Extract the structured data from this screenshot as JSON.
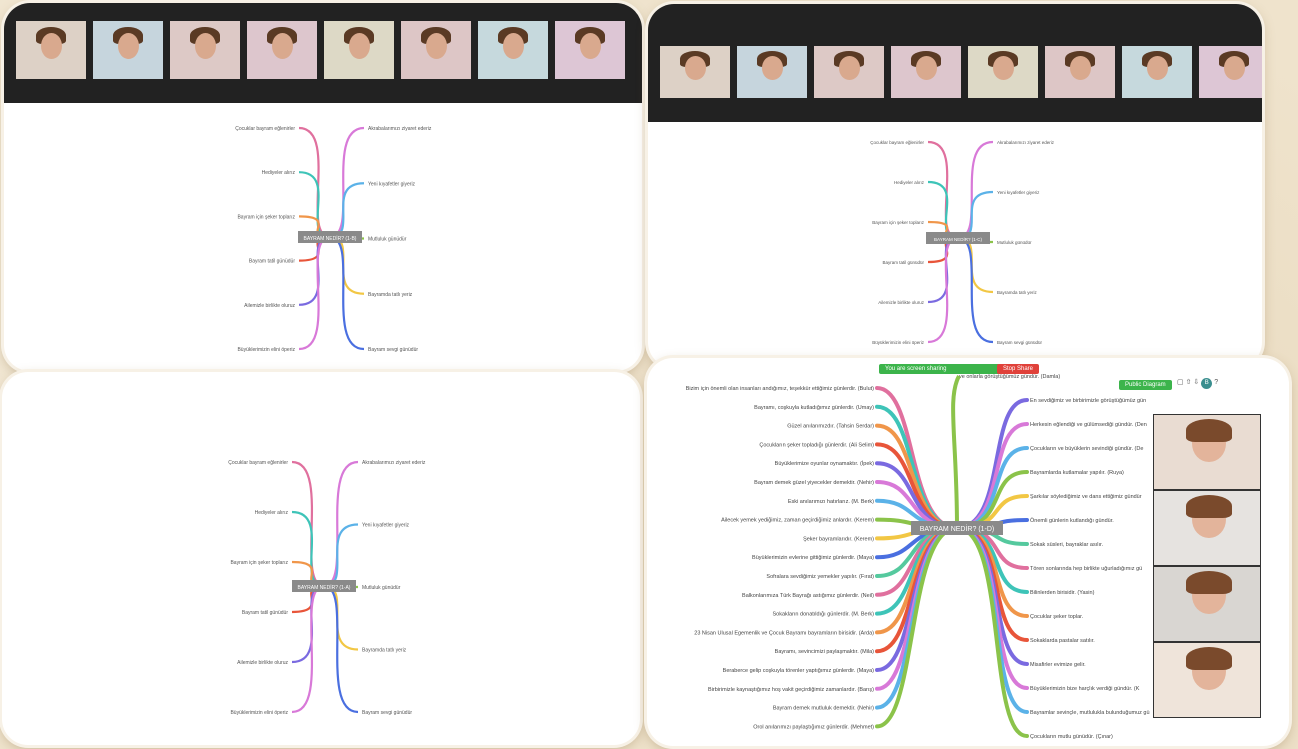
{
  "screen1": {
    "participants": [
      "",
      "",
      "",
      "",
      "",
      "",
      "",
      ""
    ],
    "center": "BAYRAM NEDİR? (1-B)",
    "branches": [
      "Çocuklar bayram eğlenirler",
      "Hediyeler alırız",
      "Bayram için şeker toplarız",
      "Bayram tatil günüdür",
      "Ailemizle birlikte oluruz",
      "Büyüklerimizin elini öperiz",
      "Akrabalarımızı ziyaret ederiz",
      "Yeni kıyafetler giyeriz",
      "Mutluluk günüdür",
      "Bayramda tatlı yeriz",
      "Bayram sevgi günüdür"
    ]
  },
  "screen2": {
    "participants": [
      "",
      "",
      "",
      "",
      "",
      "",
      "",
      ""
    ],
    "center": "BAYRAM NEDİR? (1-C)",
    "branches": [
      "Çocuklar bayram eğlenirler",
      "Hediyeler alırız",
      "Bayram için şeker toplarız",
      "Bayram tatil günüdür",
      "Ailemizle birlikte oluruz",
      "Büyüklerimizin elini öperiz",
      "Akrabalarımızı ziyaret ederiz",
      "Yeni kıyafetler giyeriz",
      "Mutluluk günüdür",
      "Bayramda tatlı yeriz",
      "Bayram sevgi günüdür"
    ]
  },
  "screen3": {
    "center": "BAYRAM NEDİR? (1-A)",
    "branches": [
      "Çocuklar bayram eğlenirler",
      "Hediyeler alırız",
      "Bayram için şeker toplarız",
      "Bayram tatil günüdür",
      "Ailemizle birlikte oluruz",
      "Büyüklerimizin elini öperiz",
      "Akrabalarımızı ziyaret ederiz",
      "Yeni kıyafetler giyeriz",
      "Mutluluk günüdür",
      "Bayramda tatlı yeriz",
      "Bayram sevgi günüdür"
    ]
  },
  "screen4": {
    "center": "BAYRAM NEDİR? (1-D)",
    "share_bar": "You are screen sharing",
    "stop_share": "Stop Share",
    "public_diagram": "Public Diagram",
    "top_text": "ve onlarla görüştüğümüz gündür. (Damla)",
    "left": [
      "Bizim için önemli olan insanları andığımız, teşekkür ettiğimiz günlerdir. (Bulut)",
      "Bayramı, coşkuyla kutladığımız günlerdir. (Umay)",
      "Güzel anılarımızdır. (Tahsin Serdar)",
      "Çocukların şeker topladığı günlerdir. (Ali Selim)",
      "Büyüklerimize oyunlar oynamaktır. (İpek)",
      "Bayram demek güzel yiyecekler demektir. (Nehir)",
      "Eski anılarımızı hatırlarız. (M. Berk)",
      "Ailecek yemek yediğimiz, zaman geçirdiğimiz anlardır. (Kerem)",
      "Şeker bayramlarıdır. (Kerem)",
      "Büyüklerimizin evlerine gittiğimiz günlerdir. (Maya)",
      "Sofralara sevdiğimiz yemekler yapılır. (Fırat)",
      "Balkonlarımıza Türk Bayrağı astığımız günlerdir. (Neil)",
      "Sokakların donatıldığı günlerdir. (M. Berk)",
      "23 Nisan Ulusal Egemenlik ve Çocuk Bayramı bayramların birisidir. (Arda)",
      "Bayramı, sevincimizi paylaşmaktır. (Mila)",
      "Beraberce gelip coşkuyla törenler yaptığımız günlerdir. (Maya)",
      "Birbirimizle kaynaştığımız hoş vakit geçirdiğimiz zamanlardır. (Barış)",
      "Bayram demek mutluluk demektir. (Nehir)",
      "Orol anılarımızı paylaştığımız günlerdir. (Mehmet)"
    ],
    "right": [
      "En sevdiğimiz ve birbirimizle görüştüğümüz gündür. (Maya)",
      "Herkesin eğlendiği ve gülümsediği gündür. (Deniz Ada)",
      "Çocukların ve büyüklerin sevindiği gündür. (Deren)",
      "Bayramlarda kutlamalar yapılır. (Ruya)",
      "Şarkılar söylediğimiz ve dans ettiğimiz gündür. (Sahar)",
      "Önemli günlerin kutlandığı gündür.",
      "Sokak süsleri, bayraklar asılır.",
      "Tören sonlarında hep birlikte uğurladığımız günlerdir.",
      "Bilinlerden birisidir. (Yasin)",
      "Çocuklar şeker toplar.",
      "Sokaklarda pastalar satılır.",
      "Misafirler evimize gelir.",
      "Büyüklerimizin bize harçlık verdiği gündür. (Kerem)",
      "Bayramlar sevinçle, mutlulukla bulunduğumuz günlerdir. (Berk)",
      "Çocukların mutlu günüdür. (Çınar)"
    ],
    "videos": [
      "",
      "",
      "",
      ""
    ]
  },
  "colors": {
    "c1": "#e0709e",
    "c2": "#3ec4b8",
    "c3": "#f0964a",
    "c4": "#e8553a",
    "c5": "#7a6ae0",
    "c6": "#d879d8",
    "c7": "#5bb2e8",
    "c8": "#8bc34a",
    "c9": "#f2c744",
    "c10": "#4a6fe0",
    "c11": "#55c99e"
  }
}
